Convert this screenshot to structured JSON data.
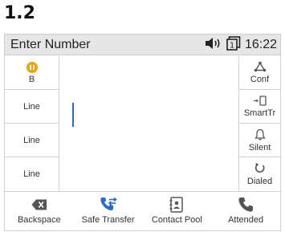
{
  "page": {
    "heading": "1.2"
  },
  "status_bar": {
    "title": "Enter Number",
    "time": "16:22",
    "line_badge": "1"
  },
  "left_keys": [
    {
      "label": "B",
      "icon": "hold-indicator-icon"
    },
    {
      "label": "Line"
    },
    {
      "label": "Line"
    },
    {
      "label": "Line"
    }
  ],
  "right_keys": [
    {
      "label": "Conf",
      "icon": "conference-icon"
    },
    {
      "label": "SmartTr",
      "icon": "smart-transfer-icon"
    },
    {
      "label": "Silent",
      "icon": "bell-icon"
    },
    {
      "label": "Dialed",
      "icon": "redial-icon"
    }
  ],
  "softkeys": [
    {
      "label": "Backspace",
      "icon": "backspace-icon"
    },
    {
      "label": "Safe Transfer",
      "icon": "safe-transfer-icon"
    },
    {
      "label": "Contact Pool",
      "icon": "contact-book-icon"
    },
    {
      "label": "Attended",
      "icon": "phone-handset-icon"
    }
  ],
  "colors": {
    "accent": "#2b6cc4",
    "hold_indicator": "#e6a417",
    "status_bar_bg": "#e6e6e6",
    "icon_dark": "#555555"
  }
}
